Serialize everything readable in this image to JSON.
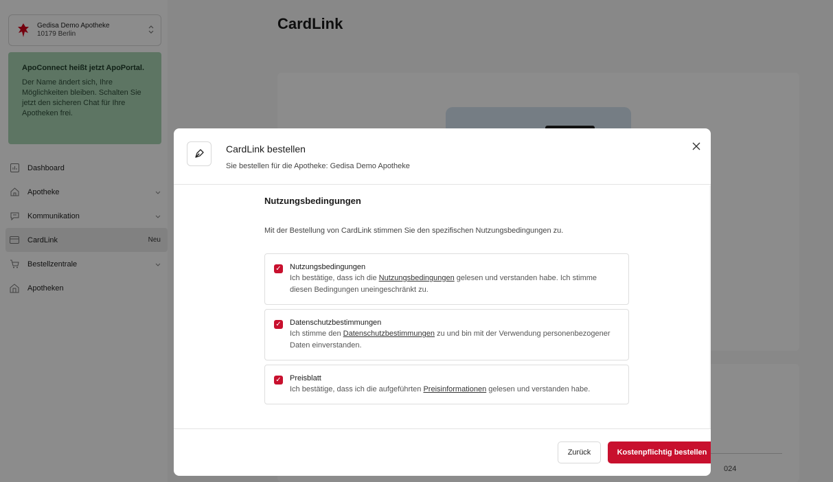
{
  "pharmacy_selector": {
    "name": "Gedisa Demo Apotheke",
    "city": "10179 Berlin",
    "chevron": "⌃⌄"
  },
  "notice": {
    "title": "ApoConnect heißt jetzt ApoPortal.",
    "body": "Der Name ändert sich, Ihre Möglichkeiten bleiben. Schalten Sie jetzt den sicheren Chat für Ihre Apotheken frei."
  },
  "nav": {
    "items": [
      {
        "label": "Dashboard",
        "icon": "chart-icon"
      },
      {
        "label": "Apotheke",
        "icon": "home-icon"
      },
      {
        "label": "Kommunikation",
        "icon": "chat-icon"
      },
      {
        "label": "CardLink",
        "icon": "card-icon",
        "badge": "Neu"
      },
      {
        "label": "Bestellzentrale",
        "icon": "cart-icon"
      },
      {
        "label": "Apotheken",
        "icon": "building-icon"
      }
    ]
  },
  "page": {
    "title": "CardLink",
    "card2_year": "024"
  },
  "modal": {
    "title": "CardLink bestellen",
    "subtitle": "Sie bestellen für die Apotheke: Gedisa Demo Apotheke",
    "section_title": "Nutzungsbedingungen",
    "section_intro": "Mit der Bestellung von CardLink stimmen Sie den spezifischen Nutzungsbedingungen zu.",
    "consents": [
      {
        "title": "Nutzungsbedingungen",
        "text_before": "Ich bestätige, dass ich die ",
        "link": "Nutzungsbedingungen",
        "text_after": " gelesen und verstanden habe. Ich stimme diesen Bedingungen uneingeschränkt zu.",
        "checked": true
      },
      {
        "title": "Datenschutzbestimmungen",
        "text_before": "Ich stimme den ",
        "link": "Datenschutzbestimmungen",
        "text_after": " zu und bin mit der Verwendung personenbezogener Daten einverstanden.",
        "checked": true
      },
      {
        "title": "Preisblatt",
        "text_before": "Ich bestätige, dass ich die aufgeführten ",
        "link": "Preisinformationen",
        "text_after": " gelesen und verstanden habe.",
        "checked": true
      }
    ],
    "back_label": "Zurück",
    "order_label": "Kostenpflichtig bestellen"
  },
  "colors": {
    "accent": "#c8102e",
    "notice_bg": "#a9d5b4"
  }
}
